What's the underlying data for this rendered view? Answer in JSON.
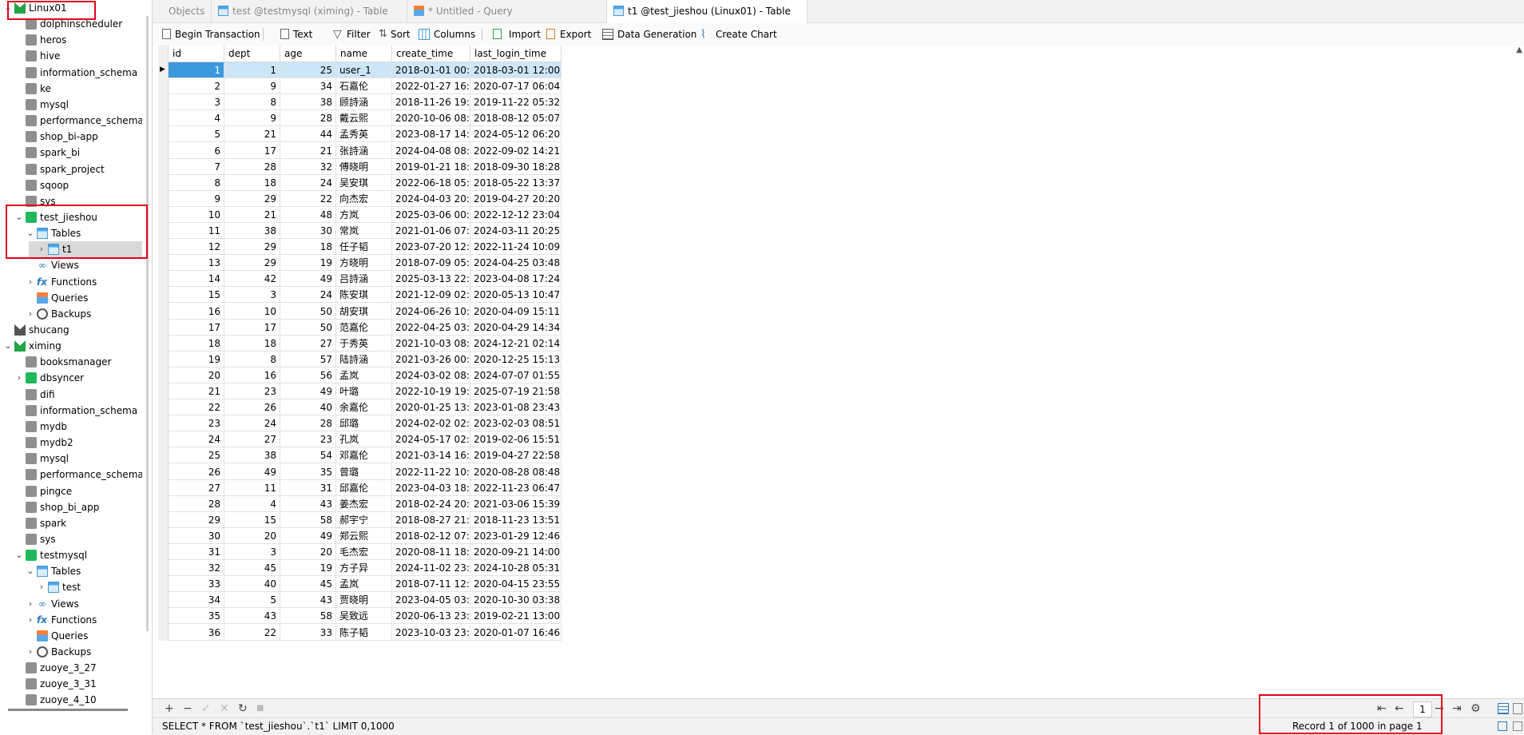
{
  "sidebar": {
    "items": [
      {
        "label": "Linux01",
        "icon": "connection-icon",
        "expanded": true
      },
      {
        "label": "dolphinscheduler",
        "icon": "database-icon"
      },
      {
        "label": "heros",
        "icon": "database-icon"
      },
      {
        "label": "hive",
        "icon": "database-icon"
      },
      {
        "label": "information_schema",
        "icon": "database-icon"
      },
      {
        "label": "ke",
        "icon": "database-icon"
      },
      {
        "label": "mysql",
        "icon": "database-icon"
      },
      {
        "label": "performance_schema",
        "icon": "database-icon"
      },
      {
        "label": "shop_bi-app",
        "icon": "database-icon"
      },
      {
        "label": "spark_bi",
        "icon": "database-icon"
      },
      {
        "label": "spark_project",
        "icon": "database-icon"
      },
      {
        "label": "sqoop",
        "icon": "database-icon"
      },
      {
        "label": "sys",
        "icon": "database-icon"
      },
      {
        "label": "test_jieshou",
        "icon": "database-open-icon",
        "expanded": true
      },
      {
        "label": "Tables",
        "icon": "tables-icon",
        "expanded": true
      },
      {
        "label": "t1",
        "icon": "table-icon",
        "selected": true
      },
      {
        "label": "Views",
        "icon": "views-icon"
      },
      {
        "label": "Functions",
        "icon": "functions-icon"
      },
      {
        "label": "Queries",
        "icon": "queries-icon"
      },
      {
        "label": "Backups",
        "icon": "backups-icon"
      },
      {
        "label": "shucang",
        "icon": "connection-icon"
      },
      {
        "label": "ximing",
        "icon": "connection-icon",
        "expanded": true
      },
      {
        "label": "booksmanager",
        "icon": "database-icon"
      },
      {
        "label": "dbsyncer",
        "icon": "database-open-icon"
      },
      {
        "label": "difi",
        "icon": "database-icon"
      },
      {
        "label": "information_schema",
        "icon": "database-icon"
      },
      {
        "label": "mydb",
        "icon": "database-icon"
      },
      {
        "label": "mydb2",
        "icon": "database-icon"
      },
      {
        "label": "mysql",
        "icon": "database-icon"
      },
      {
        "label": "performance_schema",
        "icon": "database-icon"
      },
      {
        "label": "pingce",
        "icon": "database-icon"
      },
      {
        "label": "shop_bi_app",
        "icon": "database-icon"
      },
      {
        "label": "spark",
        "icon": "database-icon"
      },
      {
        "label": "sys",
        "icon": "database-icon"
      },
      {
        "label": "testmysql",
        "icon": "database-open-icon",
        "expanded": true
      },
      {
        "label": "Tables",
        "icon": "tables-icon",
        "expanded": true
      },
      {
        "label": "test",
        "icon": "table-icon"
      },
      {
        "label": "Views",
        "icon": "views-icon"
      },
      {
        "label": "Functions",
        "icon": "functions-icon"
      },
      {
        "label": "Queries",
        "icon": "queries-icon"
      },
      {
        "label": "Backups",
        "icon": "backups-icon"
      },
      {
        "label": "zuoye_3_27",
        "icon": "database-icon"
      },
      {
        "label": "zuoye_3_31",
        "icon": "database-icon"
      },
      {
        "label": "zuoye_4_10",
        "icon": "database-icon"
      }
    ]
  },
  "tabs": [
    {
      "label": "Objects",
      "active": false
    },
    {
      "label": "test @testmysql (ximing) - Table",
      "active": false
    },
    {
      "label": "* Untitled - Query",
      "active": false
    },
    {
      "label": "t1 @test_jieshou (Linux01) - Table",
      "active": true
    }
  ],
  "toolbar": {
    "begin_transaction": "Begin Transaction",
    "text": "Text",
    "filter": "Filter",
    "sort": "Sort",
    "columns": "Columns",
    "import": "Import",
    "export": "Export",
    "data_generation": "Data Generation",
    "create_chart": "Create Chart"
  },
  "table": {
    "columns": [
      "id",
      "dept",
      "age",
      "name",
      "create_time",
      "last_login_time"
    ],
    "rows": [
      [
        "1",
        "1",
        "25",
        "user_1",
        "2018-01-01 00:",
        "2018-03-01 12:00:"
      ],
      [
        "2",
        "9",
        "34",
        "石嘉伦",
        "2022-01-27 16:",
        "2020-07-17 06:04:"
      ],
      [
        "3",
        "8",
        "38",
        "顾詩涵",
        "2018-11-26 19:",
        "2019-11-22 05:32:"
      ],
      [
        "4",
        "9",
        "28",
        "戴云熙",
        "2020-10-06 08:",
        "2018-08-12 05:07:"
      ],
      [
        "5",
        "21",
        "44",
        "孟秀英",
        "2023-08-17 14:",
        "2024-05-12 06:20:"
      ],
      [
        "6",
        "17",
        "21",
        "张詩涵",
        "2024-04-08 08:",
        "2022-09-02 14:21:"
      ],
      [
        "7",
        "28",
        "32",
        "傅晓明",
        "2019-01-21 18:",
        "2018-09-30 18:28:"
      ],
      [
        "8",
        "18",
        "24",
        "吴安琪",
        "2022-06-18 05:",
        "2018-05-22 13:37:"
      ],
      [
        "9",
        "29",
        "22",
        "向杰宏",
        "2024-04-03 20:",
        "2019-04-27 20:20:"
      ],
      [
        "10",
        "21",
        "48",
        "方岚",
        "2025-03-06 00:",
        "2022-12-12 23:04:"
      ],
      [
        "11",
        "38",
        "30",
        "常岚",
        "2021-01-06 07:",
        "2024-03-11 20:25:"
      ],
      [
        "12",
        "29",
        "18",
        "任子韬",
        "2023-07-20 12:",
        "2022-11-24 10:09:"
      ],
      [
        "13",
        "29",
        "19",
        "方晓明",
        "2018-07-09 05:",
        "2024-04-25 03:48:"
      ],
      [
        "14",
        "42",
        "49",
        "吕詩涵",
        "2025-03-13 22:",
        "2023-04-08 17:24:"
      ],
      [
        "15",
        "3",
        "24",
        "陈安琪",
        "2021-12-09 02:",
        "2020-05-13 10:47:"
      ],
      [
        "16",
        "10",
        "50",
        "胡安琪",
        "2024-06-26 10:",
        "2020-04-09 15:11:"
      ],
      [
        "17",
        "17",
        "50",
        "范嘉伦",
        "2022-04-25 03:",
        "2020-04-29 14:34:"
      ],
      [
        "18",
        "18",
        "27",
        "于秀英",
        "2021-10-03 08:",
        "2024-12-21 02:14:"
      ],
      [
        "19",
        "8",
        "57",
        "陆詩涵",
        "2021-03-26 00:",
        "2020-12-25 15:13:"
      ],
      [
        "20",
        "16",
        "56",
        "孟岚",
        "2024-03-02 08:",
        "2024-07-07 01:55:"
      ],
      [
        "21",
        "23",
        "49",
        "叶璐",
        "2022-10-19 19:",
        "2025-07-19 21:58:"
      ],
      [
        "22",
        "26",
        "40",
        "余嘉伦",
        "2020-01-25 13:",
        "2023-01-08 23:43:"
      ],
      [
        "23",
        "24",
        "28",
        "邱璐",
        "2024-02-02 02:",
        "2023-02-03 08:51:"
      ],
      [
        "24",
        "27",
        "23",
        "孔岚",
        "2024-05-17 02:",
        "2019-02-06 15:51:"
      ],
      [
        "25",
        "38",
        "54",
        "邓嘉伦",
        "2021-03-14 16:",
        "2019-04-27 22:58:"
      ],
      [
        "26",
        "49",
        "35",
        "曾璐",
        "2022-11-22 10:",
        "2020-08-28 08:48:"
      ],
      [
        "27",
        "11",
        "31",
        "邱嘉伦",
        "2023-04-03 18:",
        "2022-11-23 06:47:"
      ],
      [
        "28",
        "4",
        "43",
        "姜杰宏",
        "2018-02-24 20:",
        "2021-03-06 15:39:"
      ],
      [
        "29",
        "15",
        "58",
        "郝宇宁",
        "2018-08-27 21:",
        "2018-11-23 13:51:"
      ],
      [
        "30",
        "20",
        "49",
        "郑云熙",
        "2018-02-12 07:",
        "2023-01-29 12:46:"
      ],
      [
        "31",
        "3",
        "20",
        "毛杰宏",
        "2020-08-11 18:",
        "2020-09-21 14:00:"
      ],
      [
        "32",
        "45",
        "19",
        "方子异",
        "2024-11-02 23:",
        "2024-10-28 05:31:"
      ],
      [
        "33",
        "40",
        "45",
        "孟岚",
        "2018-07-11 12:",
        "2020-04-15 23:55:"
      ],
      [
        "34",
        "5",
        "43",
        "贾晓明",
        "2023-04-05 03:",
        "2020-10-30 03:38:"
      ],
      [
        "35",
        "43",
        "58",
        "吴致远",
        "2020-06-13 23:",
        "2019-02-21 13:00:"
      ],
      [
        "36",
        "22",
        "33",
        "陈子韬",
        "2023-10-03 23:",
        "2020-01-07 16:46:"
      ]
    ]
  },
  "nav": {
    "add": "+",
    "remove": "−",
    "apply": "✓",
    "discard": "✕",
    "refresh": "↻",
    "stop": "■",
    "first": "⇤",
    "prev": "←",
    "page": "1",
    "next": "→",
    "last": "⇥",
    "settings": "⚙"
  },
  "status": {
    "sql": "SELECT * FROM `test_jieshou`.`t1` LIMIT 0,1000",
    "record": "Record 1 of 1000 in page 1"
  },
  "colors": {
    "highlight": "#e8001c",
    "selection": "#3c98dc",
    "row_selection": "#cde6f7"
  }
}
